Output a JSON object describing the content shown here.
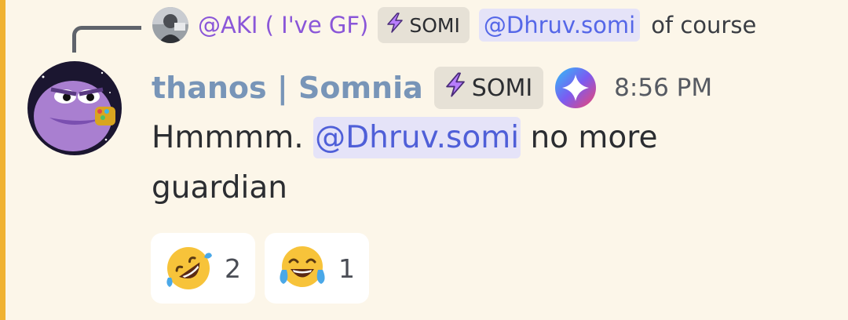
{
  "reply": {
    "author": "@AKI ( I've GF)",
    "tag": "SOMI",
    "mention": "@Dhruv.somi",
    "text": "of course",
    "author_color": "#8a56d8"
  },
  "message": {
    "username": "thanos | Somnia",
    "tag": "SOMI",
    "timestamp": "8:56 PM",
    "content_prefix": "Hmmmm. ",
    "mention": "@Dhruv.somi",
    "content_suffix": " no more guardian",
    "username_color": "#7895b8",
    "badge_icon": "nitro-badge-icon"
  },
  "reactions": [
    {
      "emoji": "rolling-on-floor-laughing-icon",
      "count": "2"
    },
    {
      "emoji": "tears-of-joy-icon",
      "count": "1"
    }
  ],
  "colors": {
    "background": "#fcf6e9",
    "highlight_bar": "#f0b232",
    "mention_bg": "#e5e3f8",
    "mention_text": "#5865f2"
  }
}
